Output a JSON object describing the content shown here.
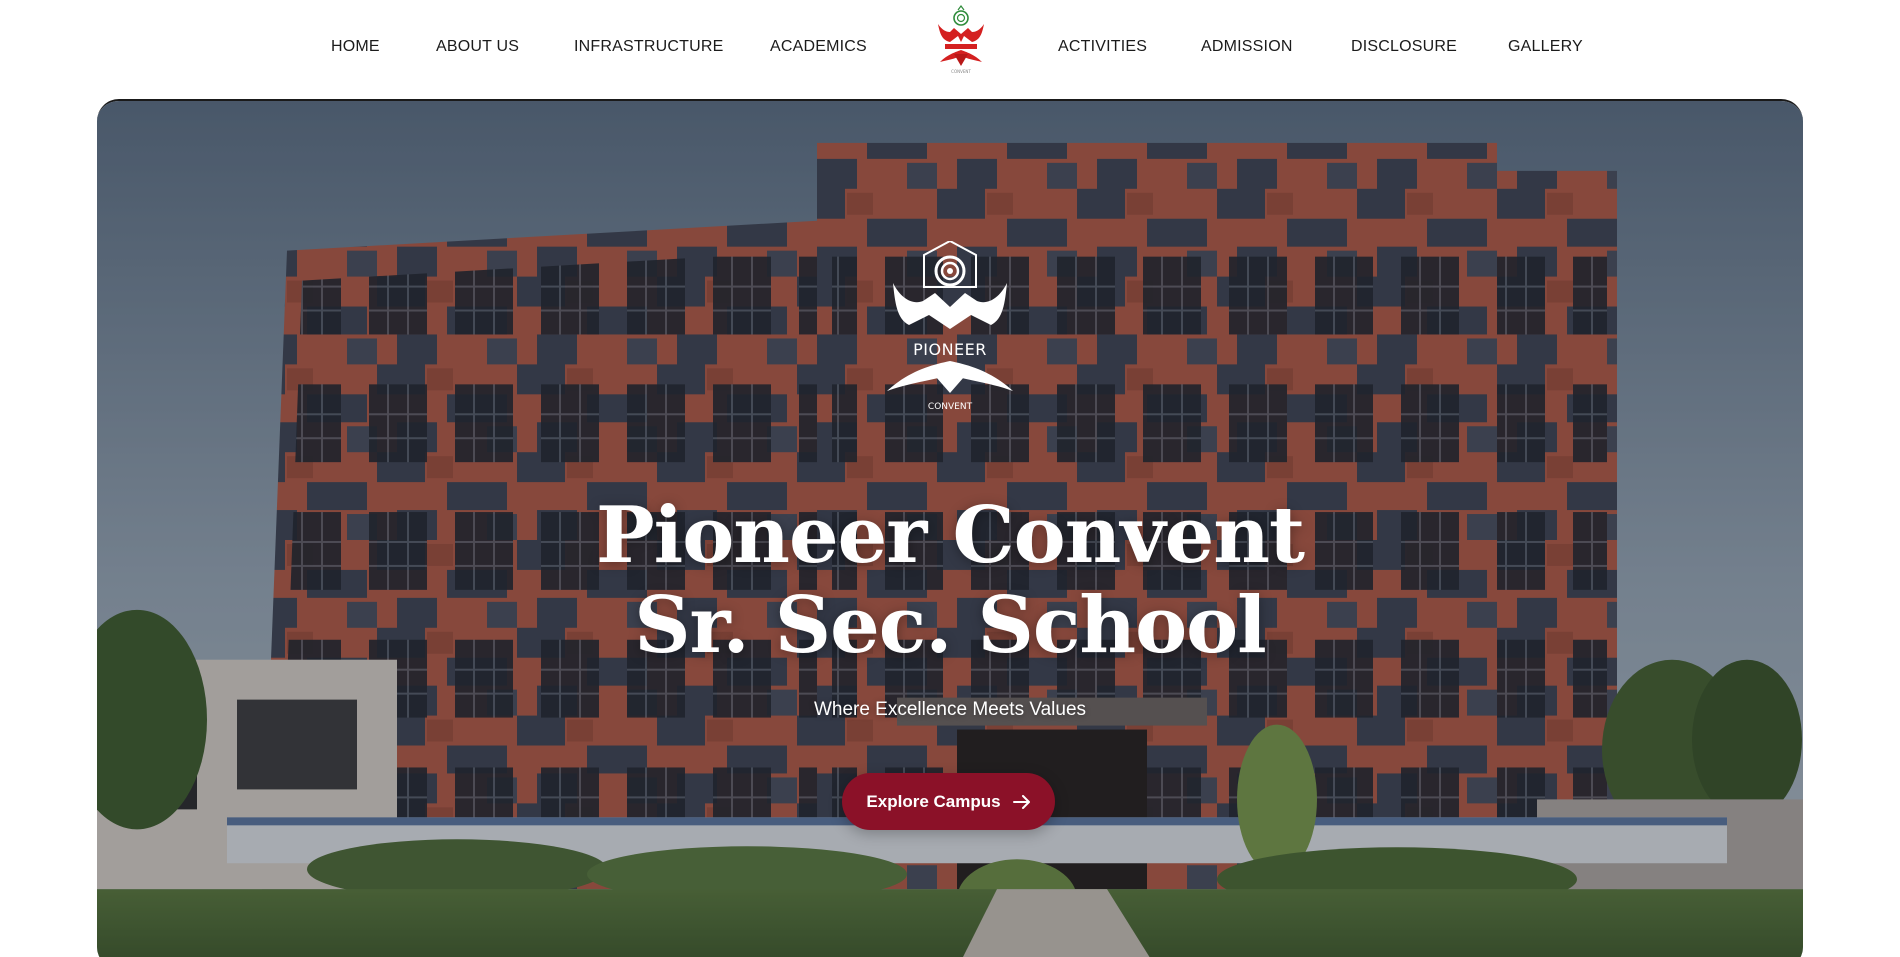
{
  "nav": {
    "left_items": [
      "HOME",
      "ABOUT US",
      "INFRASTRUCTURE",
      "ACADEMICS"
    ],
    "right_items": [
      "ACTIVITIES",
      "ADMISSION",
      "DISCLOSURE",
      "GALLERY"
    ],
    "logo_icon": "pioneer-logo-icon"
  },
  "hero": {
    "emblem_icon": "pioneer-convent-emblem-icon",
    "emblem_text_top": "PIONEER",
    "emblem_text_bottom": "CONVENT",
    "title_line1": "Pioneer Convent",
    "title_line2": "Sr. Sec. School",
    "tagline": "Where Excellence Meets Values",
    "cta_label": "Explore Campus",
    "cta_icon": "arrow-right-icon"
  },
  "colors": {
    "brand": "#8b1128",
    "logo_red": "#d42020",
    "logo_green": "#2e8b3a",
    "building_brick": "#b35a44",
    "building_slate": "#3f4552"
  }
}
